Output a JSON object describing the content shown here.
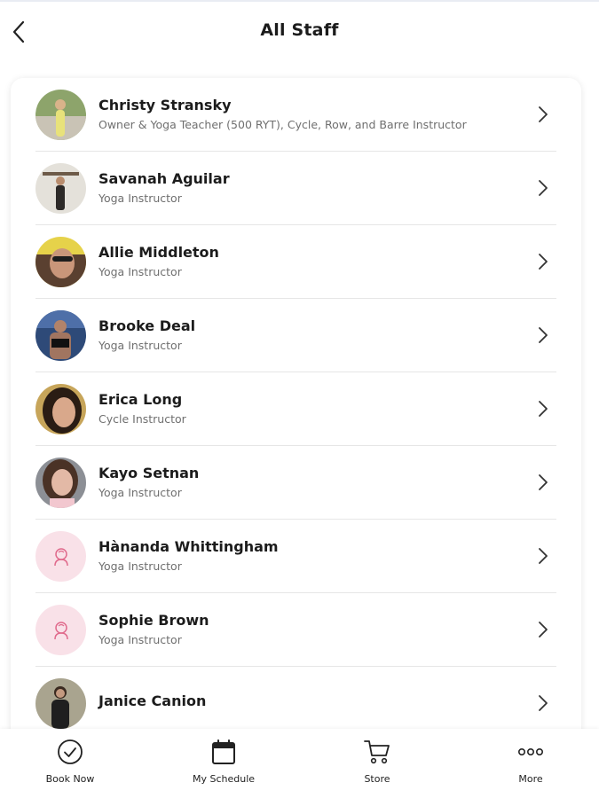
{
  "header": {
    "title": "All Staff",
    "back_icon": "chevron-left-icon"
  },
  "staff": [
    {
      "name": "Christy Stransky",
      "role": "Owner & Yoga Teacher (500 RYT), Cycle, Row, and Barre Instructor",
      "avatar": "photo"
    },
    {
      "name": "Savanah Aguilar",
      "role": "Yoga Instructor",
      "avatar": "photo"
    },
    {
      "name": "Allie Middleton",
      "role": "Yoga Instructor",
      "avatar": "photo"
    },
    {
      "name": "Brooke Deal",
      "role": "Yoga Instructor",
      "avatar": "photo"
    },
    {
      "name": "Erica Long",
      "role": "Cycle Instructor",
      "avatar": "photo"
    },
    {
      "name": "Kayo Setnan",
      "role": "Yoga Instructor",
      "avatar": "photo"
    },
    {
      "name": "Hànanda Whittingham",
      "role": "Yoga Instructor",
      "avatar": "placeholder"
    },
    {
      "name": "Sophie Brown",
      "role": "Yoga Instructor",
      "avatar": "placeholder"
    },
    {
      "name": "Janice Canion",
      "role": "",
      "avatar": "photo"
    }
  ],
  "tabbar": {
    "book_now": {
      "label": "Book Now",
      "icon": "check-circle-icon"
    },
    "my_schedule": {
      "label": "My Schedule",
      "icon": "calendar-icon"
    },
    "store": {
      "label": "Store",
      "icon": "cart-icon"
    },
    "more": {
      "label": "More",
      "icon": "more-dots-icon"
    }
  },
  "colors": {
    "placeholder_bg": "#f9e1e8",
    "placeholder_icon": "#e06a8c",
    "divider": "#e6e6e6"
  }
}
